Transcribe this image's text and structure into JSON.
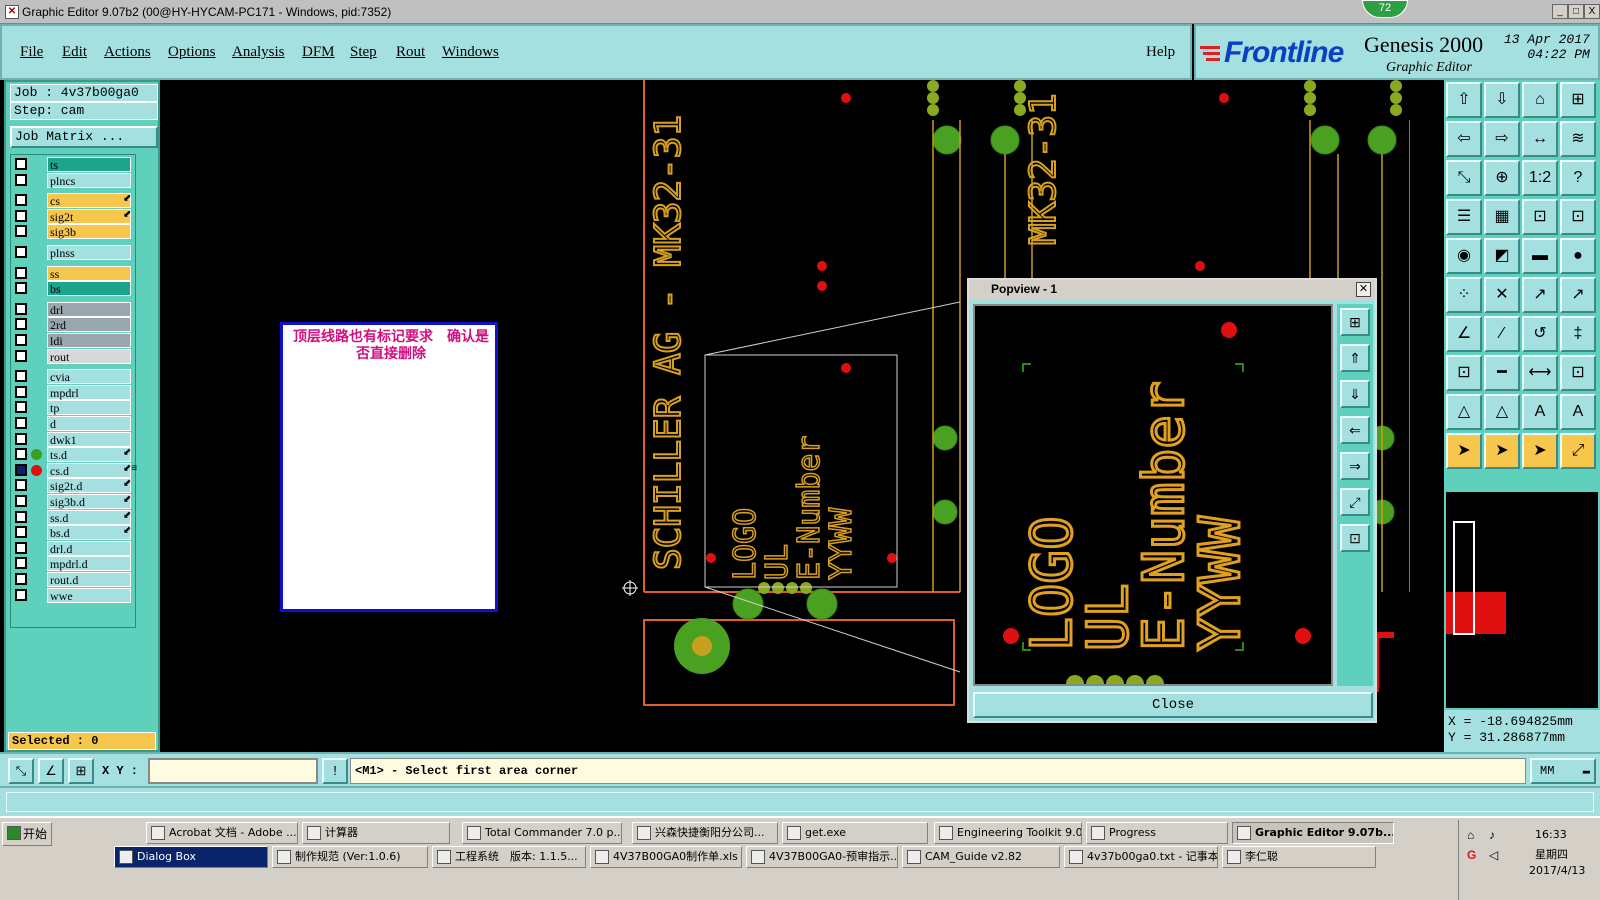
{
  "window": {
    "title": "Graphic Editor 9.07b2 (00@HY-HYCAM-PC171 - Windows, pid:7352)",
    "badge": "72",
    "minimize": "_",
    "maximize": "□",
    "close": "X"
  },
  "menu": {
    "items": [
      "File",
      "Edit",
      "Actions",
      "Options",
      "Analysis",
      "DFM",
      "Step",
      "Rout",
      "Windows"
    ],
    "help": "Help"
  },
  "brand": {
    "logo_text": "Frontline",
    "product": "Genesis 2000",
    "subtitle": "Graphic Editor",
    "date": "13 Apr 2017",
    "time": "04:22 PM"
  },
  "job": {
    "job_label": "Job : 4v37b00ga0",
    "step_label": "Step: cam",
    "matrix_button": "Job Matrix ..."
  },
  "layers": [
    {
      "name": "ts",
      "color": "#1aa58c",
      "dot": "",
      "mark": ""
    },
    {
      "name": "plncs",
      "color": "#a4e0e0",
      "dot": "",
      "mark": ""
    },
    {
      "name": "cs",
      "color": "#f7c64c",
      "dot": "",
      "mark": "⬋"
    },
    {
      "name": "sig2t",
      "color": "#f7c64c",
      "dot": "",
      "mark": "⬋"
    },
    {
      "name": "sig3b",
      "color": "#f7c64c",
      "dot": "",
      "mark": ""
    },
    {
      "name": "plnss",
      "color": "#a4e0e0",
      "dot": "",
      "mark": ""
    },
    {
      "name": "ss",
      "color": "#f7c64c",
      "dot": "",
      "mark": ""
    },
    {
      "name": "bs",
      "color": "#1aa58c",
      "dot": "",
      "mark": ""
    },
    {
      "name": "drl",
      "color": "#9aa6ae",
      "dot": "",
      "mark": ""
    },
    {
      "name": "2rd",
      "color": "#9aa6ae",
      "dot": "",
      "mark": ""
    },
    {
      "name": "ldi",
      "color": "#9aa6ae",
      "dot": "",
      "mark": ""
    },
    {
      "name": "rout",
      "color": "#d8d8d8",
      "dot": "",
      "mark": ""
    },
    {
      "name": "cvia",
      "color": "#a4e0e0",
      "dot": "",
      "mark": ""
    },
    {
      "name": "mpdrl",
      "color": "#a4e0e0",
      "dot": "",
      "mark": ""
    },
    {
      "name": "tp",
      "color": "#a4e0e0",
      "dot": "",
      "mark": ""
    },
    {
      "name": "d",
      "color": "#a4e0e0",
      "dot": "",
      "mark": ""
    },
    {
      "name": "dwk1",
      "color": "#a4e0e0",
      "dot": "",
      "mark": ""
    },
    {
      "name": "ts.d",
      "color": "#a4e0e0",
      "dot": "#3aa020",
      "mark": "⬋"
    },
    {
      "name": "cs.d",
      "color": "#a4e0e0",
      "dot": "#e01010",
      "mark": "⬋≡"
    },
    {
      "name": "sig2t.d",
      "color": "#a4e0e0",
      "dot": "",
      "mark": "⬋"
    },
    {
      "name": "sig3b.d",
      "color": "#a4e0e0",
      "dot": "",
      "mark": "⬋"
    },
    {
      "name": "ss.d",
      "color": "#a4e0e0",
      "dot": "",
      "mark": "⬋"
    },
    {
      "name": "bs.d",
      "color": "#a4e0e0",
      "dot": "",
      "mark": "⬋"
    },
    {
      "name": "drl.d",
      "color": "#a4e0e0",
      "dot": "",
      "mark": ""
    },
    {
      "name": "mpdrl.d",
      "color": "#a4e0e0",
      "dot": "",
      "mark": ""
    },
    {
      "name": "rout.d",
      "color": "#a4e0e0",
      "dot": "",
      "mark": ""
    },
    {
      "name": "wwe",
      "color": "#a4e0e0",
      "dot": "",
      "mark": ""
    }
  ],
  "selected": "Selected : 0",
  "canvas": {
    "vertical_text_1": "SCHILLER AG - MK32-31",
    "vertical_text_2": "MK32-31",
    "pcb_lines": [
      "LOGO",
      "UL",
      "E-Number",
      "YYWW"
    ],
    "note": "顶层线路也有标记要求　确认是否直接删除"
  },
  "popview": {
    "title": "Popview - 1",
    "close_label": "Close",
    "side_buttons": [
      "⊞",
      "⇑",
      "⇓",
      "⇐",
      "⇒",
      "⤢",
      "⊡"
    ]
  },
  "tools": [
    "⇧",
    "⇩",
    "⌂",
    "⊞",
    "⇦",
    "⇨",
    "↔",
    "≋",
    "⤡",
    "⊕",
    "1:2",
    "?",
    "☰",
    "▦",
    "⊡",
    "⊡",
    "◉",
    "◩",
    "▬",
    "●",
    "⁘",
    "✕",
    "↗",
    "↗",
    "∠",
    "∕",
    "↺",
    "‡",
    "⊡",
    "━",
    "⟷",
    "⊡",
    "△",
    "△",
    "A",
    "A",
    "➤",
    "➤",
    "➤",
    "⤢"
  ],
  "coords": {
    "x": "X = -18.694825mm",
    "y": "Y = 31.286877mm"
  },
  "command": {
    "xy_label": "X Y :",
    "xy_value": "",
    "message": "<M1> - Select first area corner",
    "units": "MM"
  },
  "taskbar": {
    "start": "开始",
    "row1": [
      "Acrobat 文档 - Adobe ...",
      "计算器",
      "Total Commander 7.0 p...",
      "兴森快捷衡阳分公司...",
      "get.exe",
      "Engineering Toolkit 9.0...",
      "Progress",
      "Graphic Editor 9.07b..."
    ],
    "row2": [
      "Dialog Box",
      "制作规范 (Ver:1.0.6)",
      "工程系统　版本: 1.1.5...",
      "4V37B00GA0制作单.xls ...",
      "4V37B00GA0-预审指示....",
      "CAM_Guide v2.82",
      "4v37b00ga0.txt - 记事本",
      "李仁聪"
    ],
    "clock_time": "16:33",
    "clock_day": "星期四",
    "clock_date": "2017/4/13"
  }
}
